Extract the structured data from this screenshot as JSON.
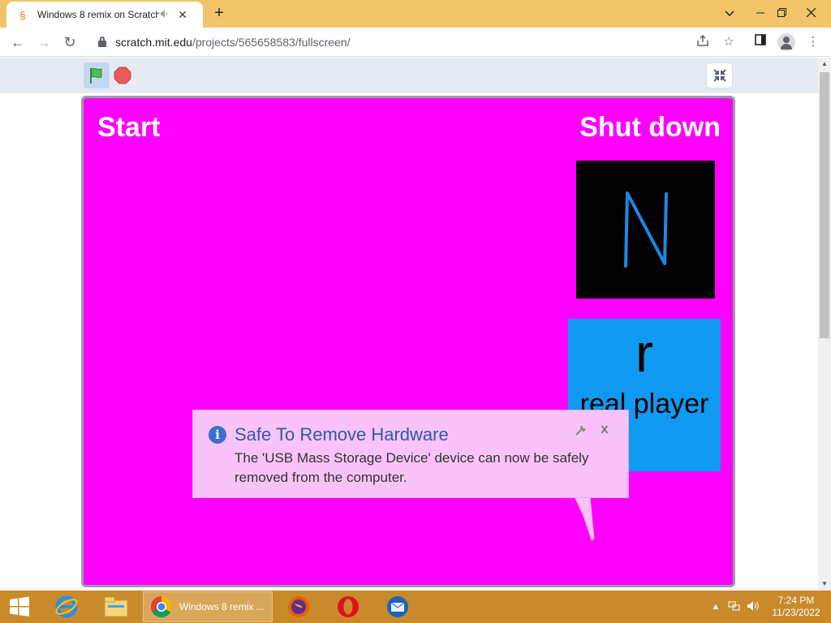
{
  "browser": {
    "tab": {
      "title": "Windows 8 remix on Scratch",
      "favicon": "scratch-icon",
      "audio_icon": "speaker-icon",
      "close_glyph": "✕"
    },
    "new_tab_glyph": "+",
    "window_controls": {
      "dropdown": "⌄",
      "minimize": "—",
      "restore": "❐",
      "close": "✕"
    },
    "nav": {
      "back": "←",
      "forward": "→",
      "reload": "↻"
    },
    "url": {
      "host": "scratch.mit.edu",
      "path": "/projects/565658583/fullscreen/"
    },
    "toolbar_icons": {
      "share": "⇪",
      "bookmark": "☆",
      "sidebar": "▯",
      "menu": "⋮"
    }
  },
  "player": {
    "controls": {
      "green_flag": "green-flag-icon",
      "stop": "stop-icon",
      "unfullscreen": "unfullscreen-icon"
    }
  },
  "stage": {
    "start_label": "Start",
    "shutdown_label": "Shut down",
    "tile_n_letter": "N",
    "tile_real": {
      "letter": "r",
      "label": "real player"
    },
    "colors": {
      "background": "#ff00ff",
      "tile_n_bg": "#000000",
      "tile_n_letter": "#1e88e5",
      "tile_real_bg": "#0f99f0"
    }
  },
  "notification": {
    "icon": "info-icon",
    "title": "Safe To Remove Hardware",
    "message": "The 'USB Mass Storage Device' device can now be safely removed from the computer.",
    "settings_icon": "wrench-icon",
    "close_glyph": "x"
  },
  "scrollbar": {
    "up": "▲",
    "down": "▼",
    "scroll_fraction": 0.0
  },
  "taskbar": {
    "start": "windows-start-icon",
    "pinned": [
      "internet-explorer-icon",
      "file-explorer-icon"
    ],
    "active_app": {
      "icon": "chrome-icon",
      "title": "Windows 8 remix ..."
    },
    "other_apps": [
      "firefox-icon",
      "opera-icon",
      "thunderbird-icon"
    ],
    "tray": {
      "arrow": "▲",
      "network": "network-icon",
      "volume": "volume-icon"
    },
    "clock": {
      "time": "7:24 PM",
      "date": "11/23/2022"
    }
  }
}
